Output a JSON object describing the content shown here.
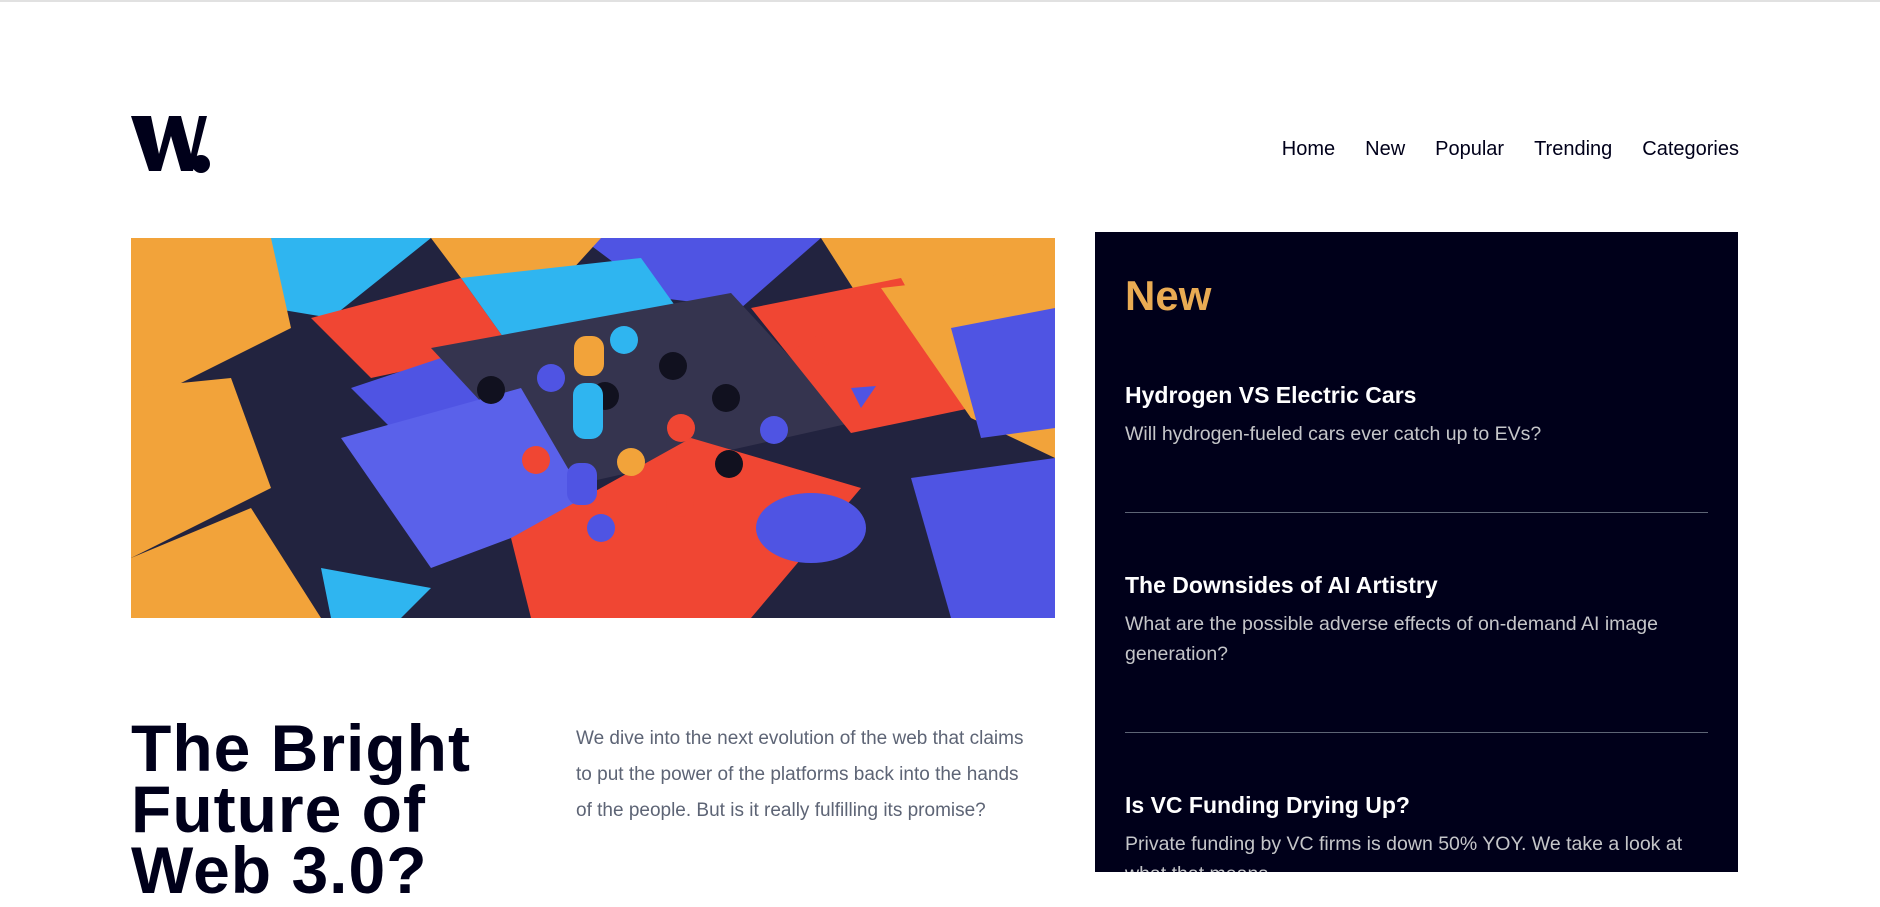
{
  "brand": {
    "logo_text": "W."
  },
  "nav": {
    "items": [
      "Home",
      "New",
      "Popular",
      "Trending",
      "Categories"
    ]
  },
  "hero": {
    "image_icon": "abstract-blocks-illustration"
  },
  "main": {
    "title": "The Bright Future of Web 3.0?",
    "description": "We dive into the next evolution of the web that claims to put the power of the platforms back into the hands of the people. But is it really fulfilling its promise?"
  },
  "sidebar": {
    "title": "New",
    "articles": [
      {
        "title": "Hydrogen VS Electric Cars",
        "summary": "Will hydrogen-fueled cars ever catch up to EVs?"
      },
      {
        "title": "The Downsides of AI Artistry",
        "summary": "What are the possible adverse effects of on-demand AI image generation?"
      },
      {
        "title": "Is VC Funding Drying Up?",
        "summary": "Private funding by VC firms is down 50% YOY. We take a look at what that means."
      }
    ]
  },
  "colors": {
    "dark_navy": "#00001a",
    "accent_orange": "#e9ab53",
    "muted_gray": "#5d6475",
    "soft_gray": "#c5c6c9"
  }
}
